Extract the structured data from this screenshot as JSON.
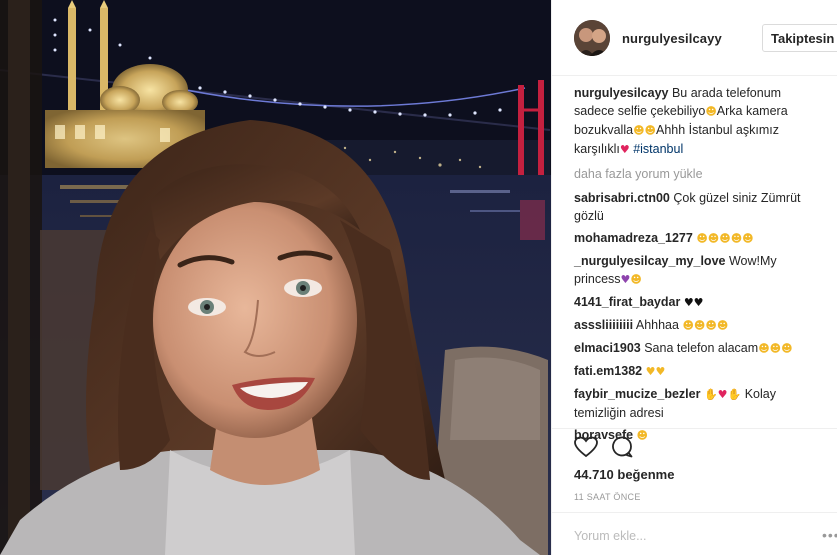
{
  "post": {
    "username": "nurgulyesilcayy",
    "follow_label": "Takiptesin",
    "caption": {
      "user": "nurgulyesilcayy",
      "text_1": " Bu arada telefonum sadece selfie çekebiliyo",
      "text_2": "Arka kamera bozukvalla",
      "text_3": "Ahhh İstanbul aşkımız karşılıklı",
      "hashtag": " #istanbul"
    },
    "load_more_label": "daha fazla yorum yükle",
    "comments": [
      {
        "user": "sabrisabri.ctn00",
        "text": " Çok güzel siniz Zümrüt gözlü"
      },
      {
        "user": "mohamadreza_1277",
        "text": " ",
        "emoji": "😍😍😍😍😍"
      },
      {
        "user": "_nurgulyesilcay_my_love",
        "text": " Wow!My princess",
        "emoji": "💜😍"
      },
      {
        "user": "4141_firat_baydar",
        "text": " ",
        "emoji": "🖤🖤"
      },
      {
        "user": "asssliiiiiiii",
        "text": " Ahhhaa ",
        "emoji": "😍😍😍😍"
      },
      {
        "user": "elmaci1903",
        "text": " Sana telefon alacam",
        "emoji": "😂😂😂"
      },
      {
        "user": "fati.em1382",
        "text": " ",
        "emoji": "💛💛"
      },
      {
        "user": "faybir_mucize_bezler",
        "text_before": " ",
        "emoji": "👏💖👏",
        "text": " Kolay temizliğin adresi"
      },
      {
        "user": "boravsefe",
        "text": " ",
        "emoji": "😂"
      }
    ],
    "likes": "44.710 beğenme",
    "time": "11 SAAT ÖNCE",
    "add_comment_placeholder": "Yorum ekle...",
    "more_label": "•••"
  },
  "colors": {
    "text": "#262626",
    "muted": "#999999",
    "hashtag": "#003569",
    "border": "#efefef"
  },
  "icons": [
    "heart-icon",
    "comment-icon",
    "more-options-icon"
  ]
}
